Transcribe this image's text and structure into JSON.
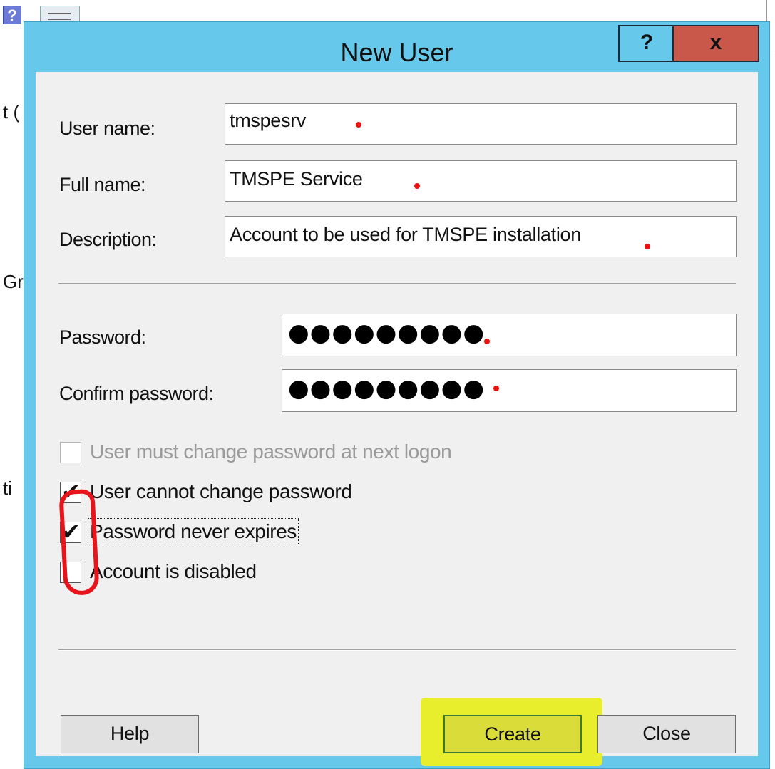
{
  "background": {
    "fragments": [
      "t (",
      "Gr",
      "ti"
    ]
  },
  "dialog": {
    "title": "New User",
    "help_glyph": "?",
    "close_glyph": "x"
  },
  "form": {
    "user_name": {
      "label": "User name:",
      "value": "tmspesrv"
    },
    "full_name": {
      "label": "Full name:",
      "value": "TMSPE Service"
    },
    "description": {
      "label": "Description:",
      "value": "Account to be used for TMSPE installation"
    },
    "password": {
      "label": "Password:",
      "value": "●●●●●●●●●"
    },
    "confirm_password": {
      "label": "Confirm password:",
      "value": "●●●●●●●●●"
    }
  },
  "checkboxes": [
    {
      "label": "User must change password at next logon",
      "checked": false,
      "enabled": false
    },
    {
      "label": "User cannot change password",
      "checked": true,
      "enabled": true
    },
    {
      "label": "Password never expires",
      "checked": true,
      "enabled": true
    },
    {
      "label": "Account is disabled",
      "checked": false,
      "enabled": true
    }
  ],
  "check_glyph": "✔",
  "buttons": {
    "help": "Help",
    "create": "Create",
    "close": "Close"
  },
  "colors": {
    "title_bar": "#66c8ea",
    "close_button": "#c9574a",
    "annotation_red": "#e8141c",
    "annotation_yellow": "#e9ee2c",
    "required_marker": "#e11111"
  }
}
